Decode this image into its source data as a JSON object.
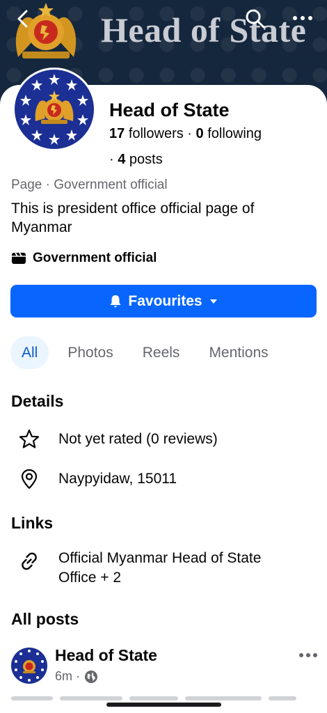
{
  "cover": {
    "title": "Head of State"
  },
  "profile": {
    "name": "Head of State",
    "followers_count": "17",
    "followers_label": "followers",
    "separator": "·",
    "following_count": "0",
    "following_label": "following",
    "posts_count": "4",
    "posts_label": "posts",
    "category_line": "Page · Government official",
    "bio": "This is president office official page of Myanmar",
    "badge": "Government official"
  },
  "actions": {
    "favourites_label": "Favourites"
  },
  "tabs": [
    {
      "label": "All",
      "active": true
    },
    {
      "label": "Photos",
      "active": false
    },
    {
      "label": "Reels",
      "active": false
    },
    {
      "label": "Mentions",
      "active": false
    }
  ],
  "details": {
    "heading": "Details",
    "rating": "Not yet rated (0 reviews)",
    "location": "Naypyidaw, 15011"
  },
  "links": {
    "heading": "Links",
    "text": "Official Myanmar Head of State Office + 2"
  },
  "posts": {
    "heading": "All posts",
    "first": {
      "author": "Head of State",
      "time": "6m",
      "dot": "·"
    }
  },
  "colors": {
    "accent": "#0866ff",
    "cover_bg": "#15273d",
    "avatar_ring": "#1b2f94",
    "emblem_gold": "#e0a02a",
    "emblem_red": "#c8291e"
  }
}
